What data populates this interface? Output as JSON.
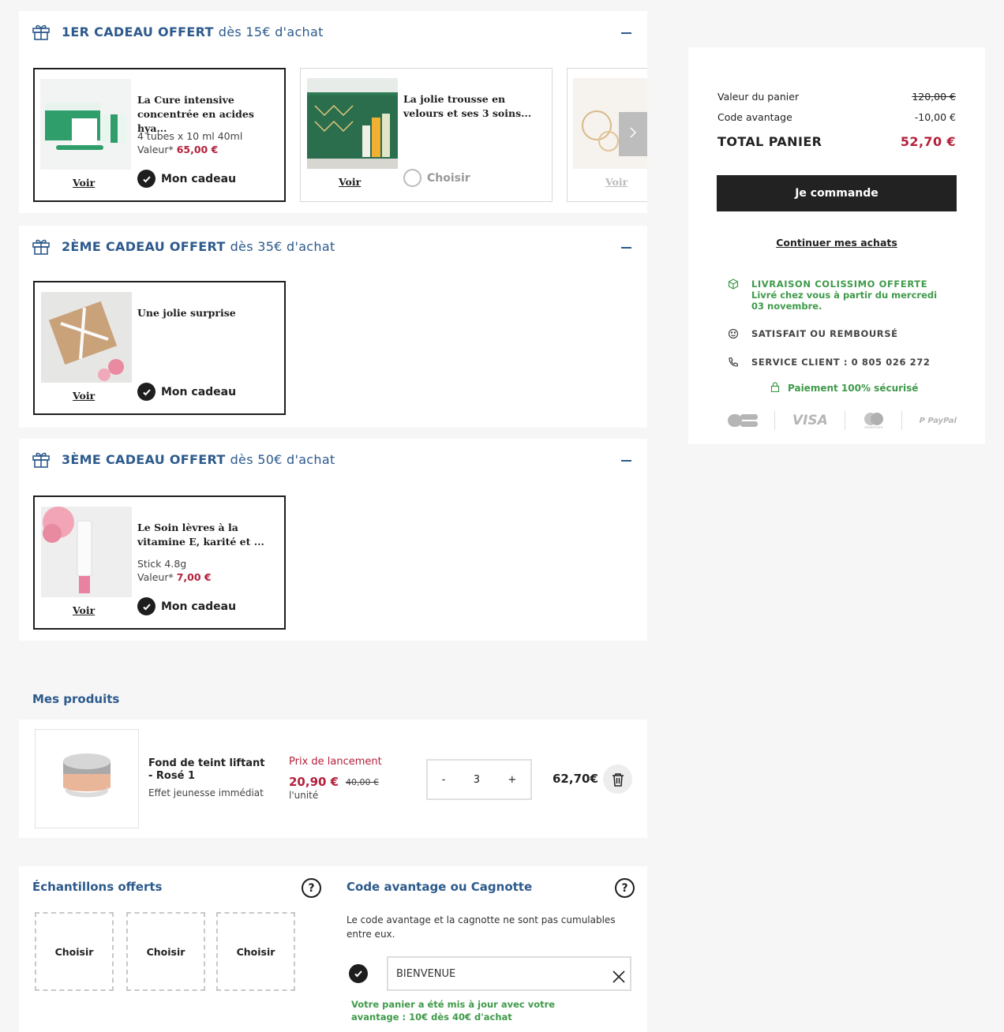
{
  "gifts": [
    {
      "number_label": "1ER CADEAU OFFERT",
      "threshold": "dès 15€ d'achat",
      "cards": [
        {
          "title": "La Cure intensive concentrée en acides hya...",
          "desc": "4 tubes x 10 ml 40ml",
          "value_label": "Valeur*",
          "value": "65,00 €",
          "voir": "Voir",
          "action": "Mon cadeau",
          "selected": true
        },
        {
          "title": "La jolie trousse en velours et ses 3 soins...",
          "voir": "Voir",
          "action": "Choisir",
          "selected": false
        },
        {
          "voir": "Voir"
        }
      ]
    },
    {
      "number_label": "2ÈME CADEAU OFFERT",
      "threshold": "dès 35€ d'achat",
      "cards": [
        {
          "title": "Une jolie surprise",
          "voir": "Voir",
          "action": "Mon cadeau",
          "selected": true
        }
      ]
    },
    {
      "number_label": "3ÈME CADEAU OFFERT",
      "threshold": "dès 50€ d'achat",
      "cards": [
        {
          "title": "Le Soin lèvres à la vitamine E, karité et ...",
          "desc": "Stick 4.8g",
          "value_label": "Valeur*",
          "value": "7,00 €",
          "voir": "Voir",
          "action": "Mon cadeau",
          "selected": true
        }
      ]
    }
  ],
  "products": {
    "heading": "Mes produits",
    "items": [
      {
        "name": "Fond de teint liftant - Rosé 1",
        "subtitle": "Effet jeunesse immédiat",
        "promo_label": "Prix de lancement",
        "price": "20,90 €",
        "old_price": "40,00 €",
        "unit": "l'unité",
        "qty_minus": "-",
        "quantity": "3",
        "qty_plus": "+",
        "total": "62,70€"
      }
    ]
  },
  "samples": {
    "heading": "Échantillons offerts",
    "help": "?",
    "slots": [
      "Choisir",
      "Choisir",
      "Choisir"
    ]
  },
  "promo": {
    "heading": "Code avantage ou Cagnotte",
    "help": "?",
    "note": "Le code avantage et la cagnotte ne sont pas cumulables entre eux.",
    "code": "BIENVENUE",
    "success": "Votre panier a été mis à jour avec votre avantage : 10€ dès 40€ d'achat"
  },
  "summary": {
    "cart_value_label": "Valeur du panier",
    "cart_value": "120,00 €",
    "code_label": "Code avantage",
    "code_value": "-10,00 €",
    "total_label": "TOTAL PANIER",
    "total_value": "52,70 €",
    "checkout": "Je commande",
    "continue": "Continuer mes achats",
    "delivery_title": "LIVRAISON COLISSIMO OFFERTE",
    "delivery_note": "Livré chez vous à partir du mercredi 03 novembre.",
    "satisfaction": "SATISFAIT OU REMBOURSÉ",
    "service": "SERVICE CLIENT : 0 805 026 272",
    "secure": "Paiement 100% sécurisé",
    "payments": [
      "CB",
      "VISA",
      "mastercard",
      "PayPal"
    ]
  },
  "colors": {
    "brand_blue": "#2d5a8c",
    "price_red": "#b4203b",
    "success_green": "#3f9a4a",
    "dark": "#222222"
  }
}
